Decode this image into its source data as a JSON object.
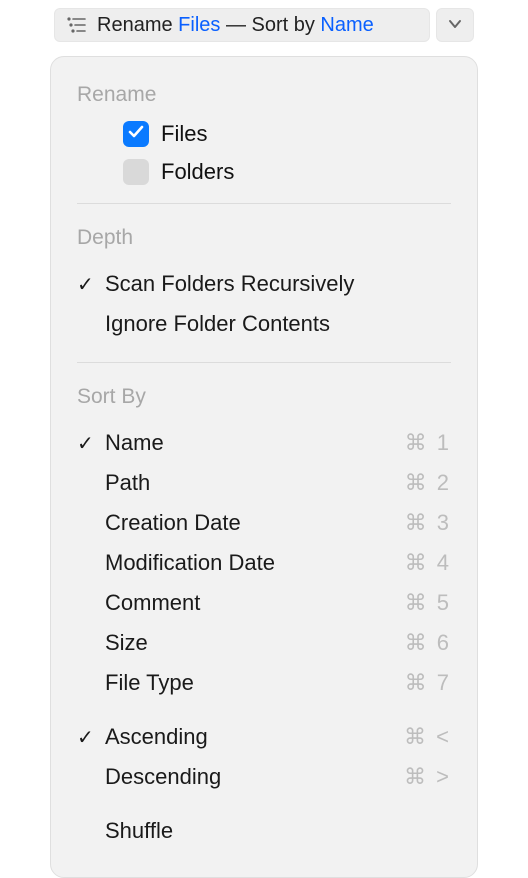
{
  "toolbar": {
    "prefix": "Rename ",
    "link1": "Files",
    "mid": " — Sort by ",
    "link2": "Name"
  },
  "sections": {
    "rename": {
      "title": "Rename",
      "files_label": "Files",
      "folders_label": "Folders",
      "files_checked": true,
      "folders_checked": false
    },
    "depth": {
      "title": "Depth",
      "scan_label": "Scan Folders Recursively",
      "ignore_label": "Ignore Folder Contents"
    },
    "sortby": {
      "title": "Sort By",
      "items": [
        {
          "label": "Name",
          "shortcut": "⌘ 1",
          "checked": true
        },
        {
          "label": "Path",
          "shortcut": "⌘ 2",
          "checked": false
        },
        {
          "label": "Creation Date",
          "shortcut": "⌘ 3",
          "checked": false
        },
        {
          "label": "Modification Date",
          "shortcut": "⌘ 4",
          "checked": false
        },
        {
          "label": "Comment",
          "shortcut": "⌘ 5",
          "checked": false
        },
        {
          "label": "Size",
          "shortcut": "⌘ 6",
          "checked": false
        },
        {
          "label": "File Type",
          "shortcut": "⌘ 7",
          "checked": false
        }
      ],
      "direction": [
        {
          "label": "Ascending",
          "shortcut": "⌘ <",
          "checked": true
        },
        {
          "label": "Descending",
          "shortcut": "⌘ >",
          "checked": false
        }
      ],
      "shuffle_label": "Shuffle"
    }
  }
}
